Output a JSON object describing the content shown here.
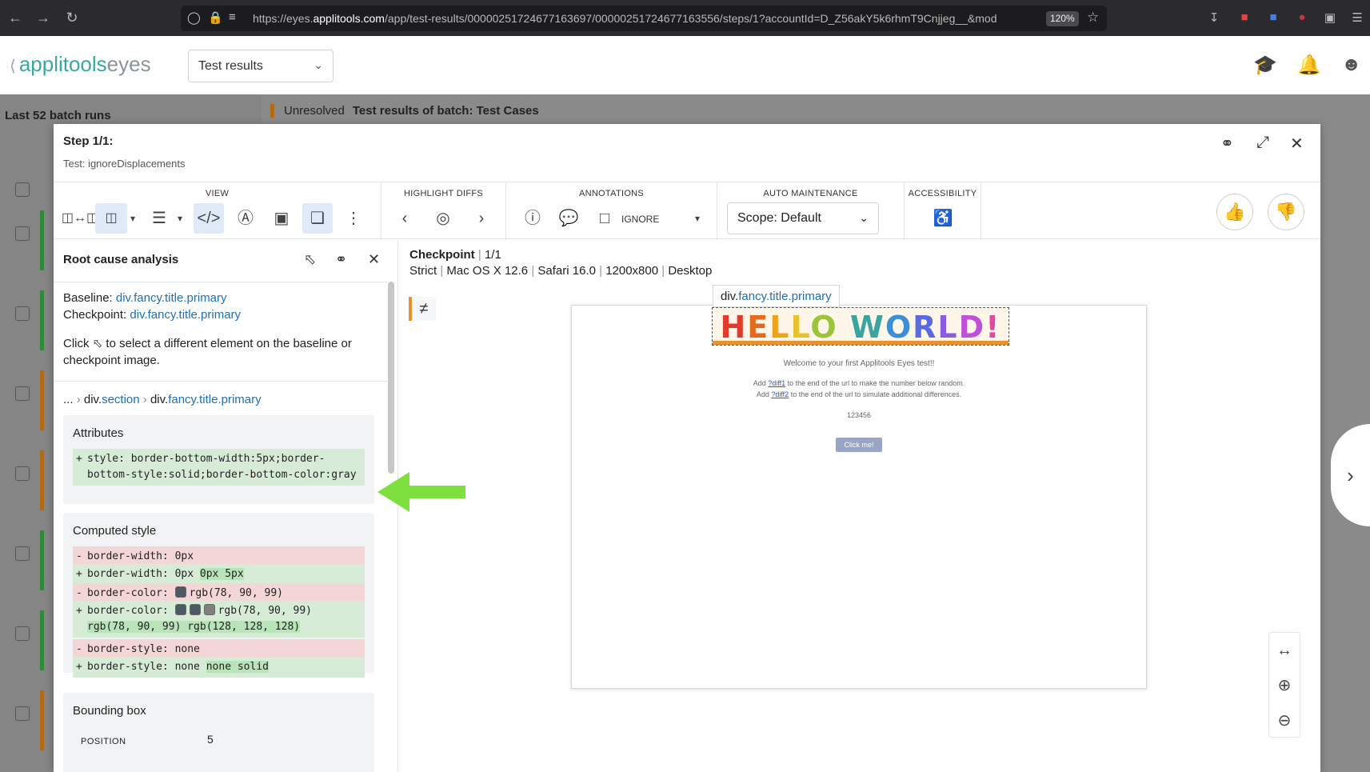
{
  "browser": {
    "url_prefix": "https://eyes.",
    "url_domain": "applitools.com",
    "url_rest": "/app/test-results/00000251724677163697/00000251724677163556/steps/1?accountId=D_Z56akY5k6rhmT9Cnjjeg__&mod",
    "zoom": "120%"
  },
  "app": {
    "logo_main": "applitools",
    "logo_eyes": "eyes",
    "section_select": "Test results"
  },
  "background": {
    "last_runs": "Last 52 batch runs",
    "status": "Unresolved",
    "batch_title": "Test results of batch:  Test Cases"
  },
  "modal": {
    "title": "Step 1/1:",
    "subtitle": "Test: ignoreDisplacements"
  },
  "toolbar": {
    "view_label": "VIEW",
    "highlight_label": "HIGHLIGHT DIFFS",
    "annotations_label": "ANNOTATIONS",
    "ignore_label": "IGNORE",
    "auto_label": "AUTO MAINTENANCE",
    "scope": "Scope: Default",
    "accessibility_label": "ACCESSIBILITY"
  },
  "rca": {
    "title": "Root cause analysis",
    "baseline_label": "Baseline: ",
    "baseline_value": "div.fancy.title.primary",
    "checkpoint_label": "Checkpoint: ",
    "checkpoint_value": "div.fancy.title.primary",
    "help_before": "Click",
    "help_after": "to select a different element on the baseline or checkpoint image.",
    "crumb_ellipsis": "...",
    "crumb_div1": "div.",
    "crumb_section": "section",
    "crumb_div2": "div.",
    "crumb_fancy": "fancy.title.primary",
    "attributes_title": "Attributes",
    "attr_style": "style: border-bottom-width:5px;border-bottom-style:solid;border-bottom-color:gray",
    "computed_title": "Computed style",
    "bw_del": "border-width: 0px",
    "bw_add_prefix": "border-width: 0px",
    "bw_add_hl": "0px 5px",
    "bc_del": "border-color:",
    "bc_del_val": "rgb(78, 90, 99)",
    "bc_add": "border-color:",
    "bc_add_val": "rgb(78, 90, 99)",
    "bc_add_hl": "rgb(78, 90, 99) rgb(128, 128, 128)",
    "bs_del": "border-style: none",
    "bs_add_prefix": "border-style: none",
    "bs_add_hl": "none solid",
    "bbox_title": "Bounding box",
    "position_label": "POSITION",
    "position_value": "5",
    "minus": "-",
    "plus": "+"
  },
  "checkpoint": {
    "label": "Checkpoint",
    "count": "1/1",
    "match": "Strict",
    "os": "Mac OS X 12.6",
    "browser": "Safari 16.0",
    "viewport": "1200x800",
    "device": "Desktop",
    "element_tip_prefix": "div.",
    "element_tip_link": "fancy.title.primary"
  },
  "screenshot": {
    "hello_letters": [
      "H",
      "E",
      "L",
      "L",
      "O",
      " ",
      "W",
      "O",
      "R",
      "L",
      "D",
      "!"
    ],
    "hello_colors": [
      "#e23b2e",
      "#e56a1f",
      "#f0a21a",
      "#eac02b",
      "#9bc43a",
      "#ffffff",
      "#3aa4a0",
      "#3b8fd6",
      "#5a6ae0",
      "#8a5be0",
      "#c050d8",
      "#e04aa2"
    ],
    "welcome": "Welcome to your first Applitools Eyes test!!",
    "line1_a": "Add ",
    "line1_link": "?diff1",
    "line1_b": " to the end of the url to make the number below random.",
    "line2_a": "Add ",
    "line2_link": "?diff2",
    "line2_b": " to the end of the url to simulate additional differences.",
    "number": "123456",
    "button": "Click me!"
  },
  "colors": {
    "accent": "#3aa89f",
    "link": "#1f6fb5",
    "diff_marker": "#e8912e",
    "swatch_dark": "#4e5a63",
    "swatch_gray": "#808080",
    "arrow": "#7ee03c"
  }
}
